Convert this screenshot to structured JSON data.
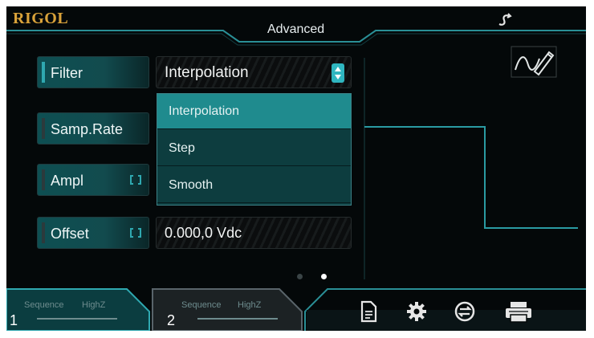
{
  "brand": "RIGOL",
  "screen_title": "Advanced",
  "params": [
    {
      "label": "Filter",
      "value": "Interpolation",
      "linked": false
    },
    {
      "label": "Samp.Rate",
      "linked": false
    },
    {
      "label": "Ampl",
      "linked": true
    },
    {
      "label": "Offset",
      "value": "0.000,0 Vdc",
      "linked": true
    }
  ],
  "filter_dropdown": {
    "options": [
      "Interpolation",
      "Step",
      "Smooth"
    ],
    "selected": "Interpolation"
  },
  "page_indicator": {
    "count": 2,
    "current": 2
  },
  "channels": [
    {
      "number": "1",
      "mode": "Sequence",
      "impedance": "HighZ"
    },
    {
      "number": "2",
      "mode": "Sequence",
      "impedance": "HighZ"
    }
  ],
  "toolbar_icons": [
    "file-icon",
    "gear-icon",
    "sync-cycle-icon",
    "printer-icon"
  ],
  "colors": {
    "accent": "#2fa8b0",
    "brand": "#d9a23a",
    "active_item": "#1f8b8e"
  }
}
